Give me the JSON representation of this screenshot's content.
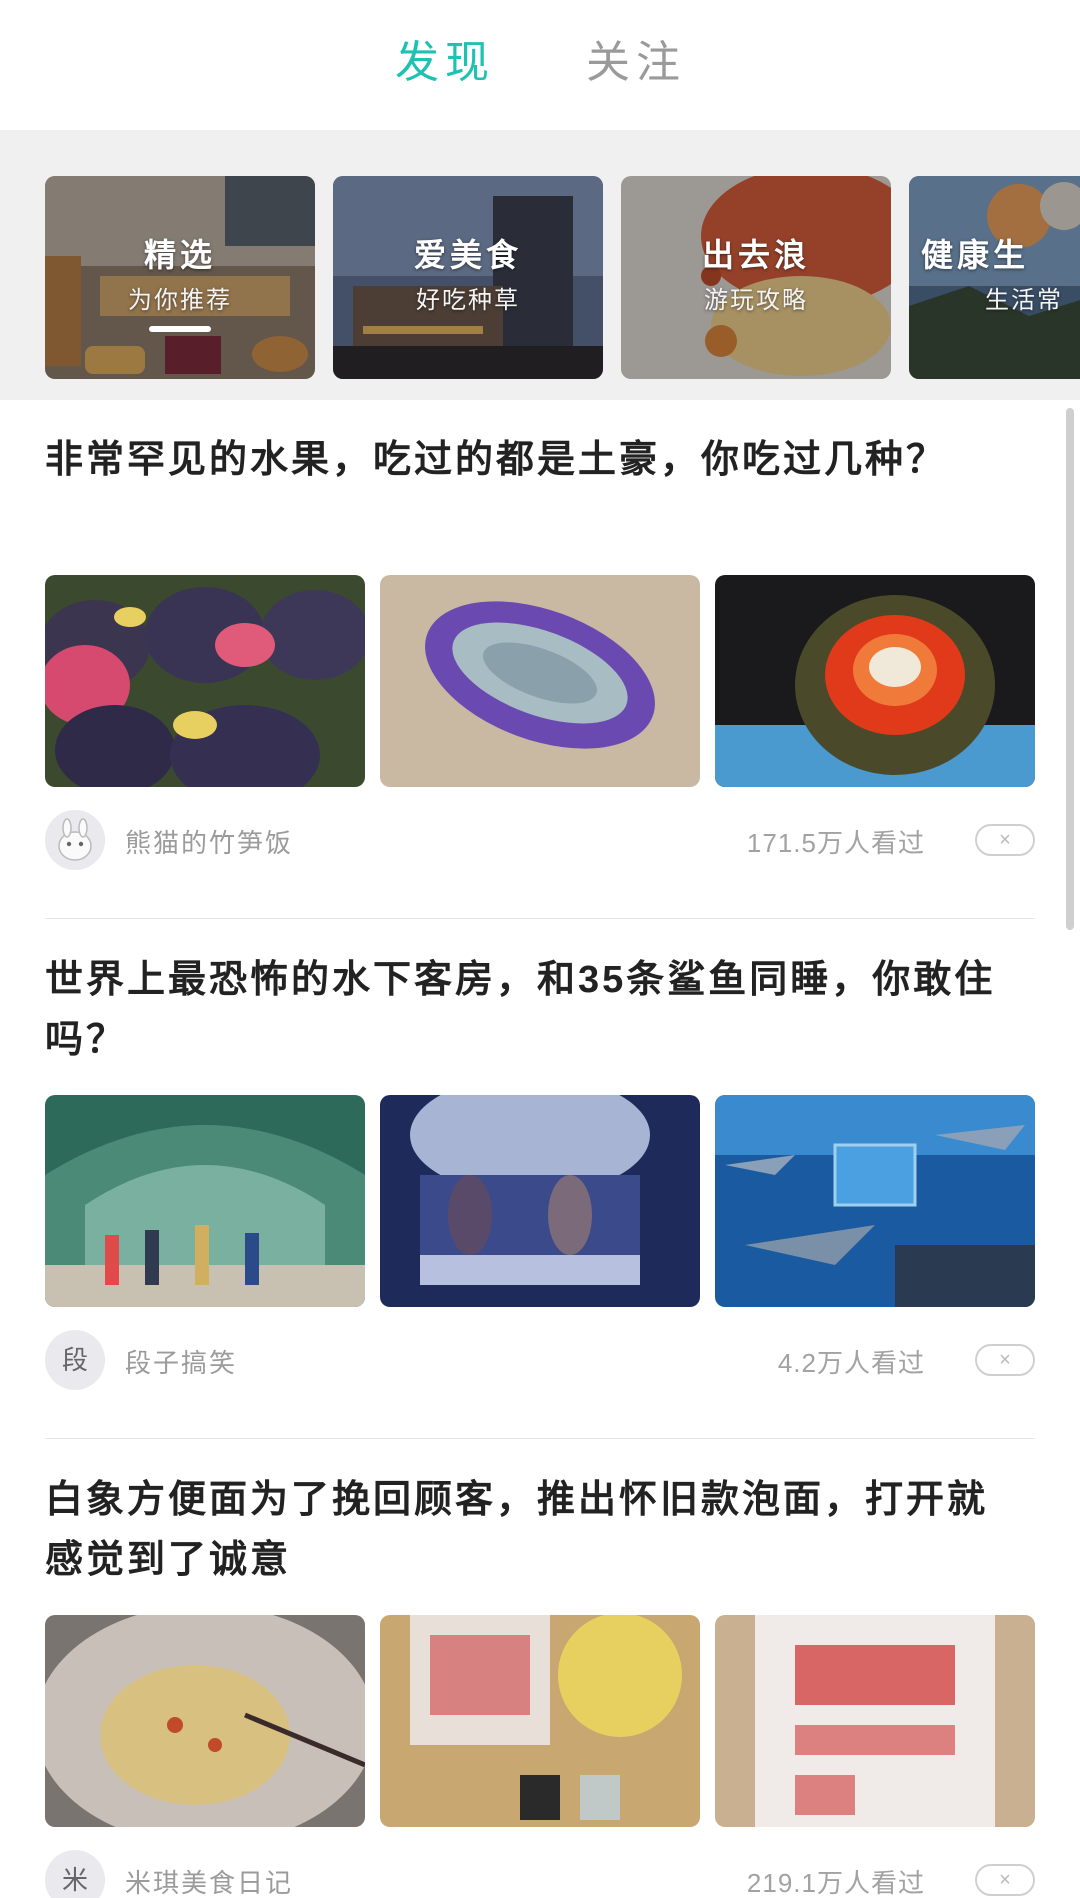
{
  "tabs": {
    "discover": "发现",
    "follow": "关注",
    "active_color": "#1fc1b3",
    "inactive_color": "#9a9a9a"
  },
  "categories": [
    {
      "title": "精选",
      "subtitle": "为你推荐",
      "selected": true
    },
    {
      "title": "爱美食",
      "subtitle": "好吃种草"
    },
    {
      "title": "出去浪",
      "subtitle": "游玩攻略"
    },
    {
      "title": "健康生",
      "subtitle": "生活常"
    }
  ],
  "articles": [
    {
      "title": "非常罕见的水果，吃过的都是土豪，你吃过几种？",
      "images": [
        "watermelon-photo",
        "purple-fruit-photo",
        "red-spiky-fruit-photo"
      ],
      "author": "熊猫的竹笋饭",
      "avatar": "panda-avatar",
      "views": "171.5万人看过",
      "dismiss": "×"
    },
    {
      "title": "世界上最恐怖的水下客房，和35条鲨鱼同睡，你敢住吗？",
      "images": [
        "aquarium-tunnel-photo",
        "underwater-room-photo",
        "sharks-room-photo"
      ],
      "author": "段子搞笑",
      "avatar": "段",
      "views": "4.2万人看过",
      "dismiss": "×"
    },
    {
      "title": "白象方便面为了挽回顾客，推出怀旧款泡面，打开就感觉到了诚意",
      "images": [
        "noodle-bowl-photo",
        "noodle-package-open-photo",
        "noodle-package-photo"
      ],
      "author": "米琪美食日记",
      "avatar": "米",
      "views": "219.1万人看过",
      "dismiss": "×"
    }
  ]
}
